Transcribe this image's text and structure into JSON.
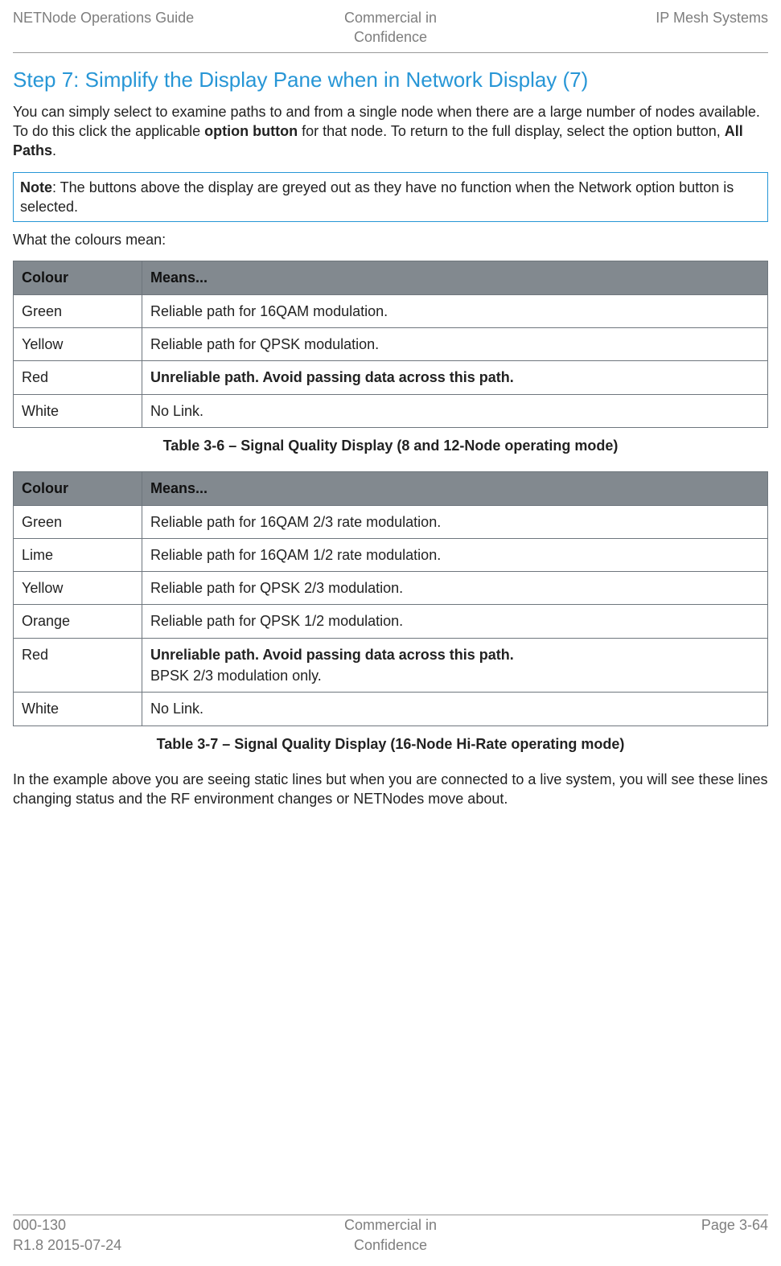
{
  "header": {
    "left": "NETNode Operations Guide",
    "center_top": "Commercial in",
    "center_bot": "Confidence",
    "right": "IP Mesh Systems"
  },
  "stepTitle": "Step 7: Simplify the Display Pane when in Network Display (7)",
  "intro": {
    "part1": "You can simply select to examine paths to and from a single node when there are a large number of nodes available. To do this click the applicable ",
    "bold1": "option button",
    "part2": " for that node. To return to the full display, select the option button, ",
    "bold2": "All Paths",
    "part3": "."
  },
  "note": {
    "label": "Note",
    "text": ": The buttons above the display are greyed out as they have no function when the Network option button is selected."
  },
  "whatColours": "What the colours mean:",
  "table1": {
    "headers": {
      "col1": "Colour",
      "col2": "Means..."
    },
    "rows": [
      {
        "c1": "Green",
        "c2": "Reliable path for 16QAM modulation.",
        "bold": false
      },
      {
        "c1": "Yellow",
        "c2": "Reliable path for QPSK modulation.",
        "bold": false
      },
      {
        "c1": "Red",
        "c2": "Unreliable path. Avoid passing data across this path.",
        "bold": true
      },
      {
        "c1": "White",
        "c2": "No Link.",
        "bold": false
      }
    ]
  },
  "caption1": "Table 3-6 – Signal Quality Display (8 and 12-Node operating mode)",
  "table2": {
    "headers": {
      "col1": "Colour",
      "col2": "Means..."
    },
    "rows": [
      {
        "c1": "Green",
        "c2": "Reliable path for 16QAM 2/3 rate modulation.",
        "bold": false
      },
      {
        "c1": "Lime",
        "c2": "Reliable path for 16QAM 1/2 rate modulation.",
        "bold": false
      },
      {
        "c1": "Yellow",
        "c2": "Reliable path for QPSK 2/3 modulation.",
        "bold": false
      },
      {
        "c1": "Orange",
        "c2": "Reliable path for QPSK 1/2 modulation.",
        "bold": false
      },
      {
        "c1": "Red",
        "c2": "Unreliable path. Avoid passing data across this path.",
        "bold": true,
        "sub": "BPSK 2/3 modulation only."
      },
      {
        "c1": "White",
        "c2": "No Link.",
        "bold": false
      }
    ]
  },
  "caption2": "Table 3-7 – Signal Quality Display (16-Node Hi-Rate operating mode)",
  "closing": "In the example above you are seeing static lines but when you are connected to a live system, you will see these lines changing status and the RF environment changes or NETNodes move about.",
  "footer": {
    "left_top": "000-130",
    "left_bot": "R1.8 2015-07-24",
    "center_top": "Commercial in",
    "center_bot": "Confidence",
    "right": "Page 3-64"
  }
}
